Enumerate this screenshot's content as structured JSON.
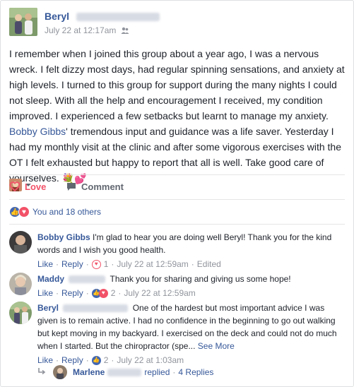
{
  "post": {
    "author": "Beryl",
    "timestamp": "July 22 at 12:17am",
    "body_1": "I remember when I joined this group about a year ago, I was a nervous wreck. I felt dizzy most days, had regular spinning sensations, and anxiety at high levels. I turned to this group for support during the many nights I could not sleep. With all the help and encouragement I received, my condition improved. I experienced a few setbacks but learnt to manage my anxiety. ",
    "mention": "Bobby Gibbs",
    "body_2": "' tremendous input and guidance was a life saver. Yesterday I had my monthly visit at the clinic and after some vigorous exercises with the OT I felt exhausted but happy to report that all is well. Take good care of yourselves. ",
    "emoji": "💐💕"
  },
  "actions": {
    "love_label": "Love",
    "comment_label": "Comment"
  },
  "reactions": {
    "summary": "You and 18 others"
  },
  "comments": [
    {
      "name": "Bobby Gibbs",
      "text": "I'm glad to hear you are doing well Beryl! Thank you for the kind words and I wish you good health.",
      "like": "Like",
      "reply": "Reply",
      "reaction_count": "1",
      "time": "July 22 at 12:59am",
      "edited": "Edited"
    },
    {
      "name": "Maddy",
      "text": "Thank you for sharing and giving us some hope!",
      "like": "Like",
      "reply": "Reply",
      "reaction_count": "2",
      "time": "July 22 at 12:59am"
    },
    {
      "name": "Beryl",
      "text": "One of the hardest but most important advice I was given is to remain active. I had no confidence in the beginning to go out walking but kept moving in my backyard. I exercised on the deck and could not do much when I started. But the chiropractor (spe...",
      "see_more": "See More",
      "like": "Like",
      "reply": "Reply",
      "reaction_count": "2",
      "time": "July 22 at 1:03am"
    }
  ],
  "reply_summary": {
    "name": "Marlene",
    "replied": "replied",
    "count": "4 Replies"
  }
}
